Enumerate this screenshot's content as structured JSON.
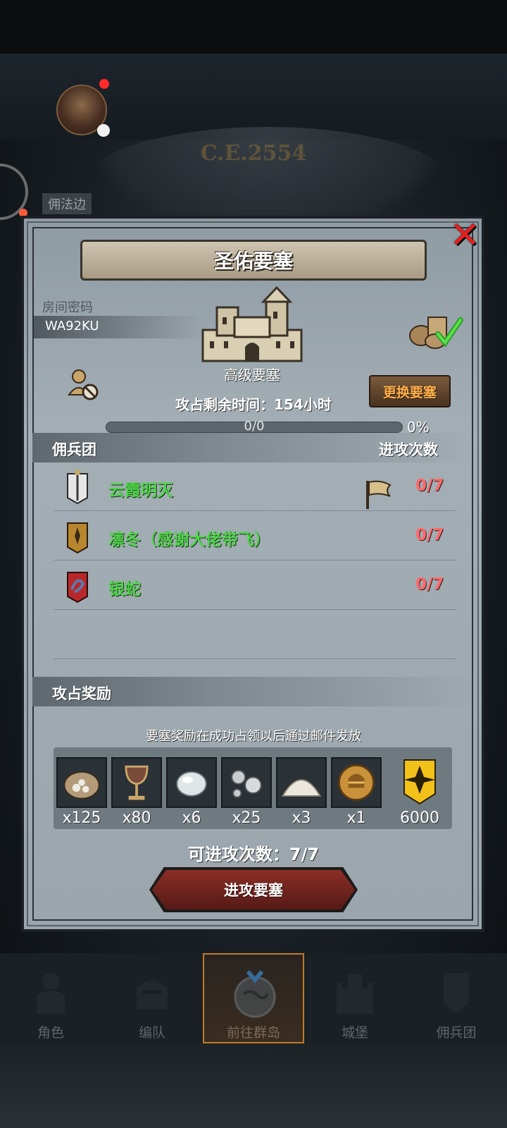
{
  "background": {
    "year_text": "C.E.2554",
    "left_label": "佣法边"
  },
  "fortress": {
    "title": "圣佑要塞",
    "room_password_label": "房间密码",
    "room_password": "WA92KU",
    "level": "高级要塞",
    "change_button": "更换要塞",
    "remaining_time": "攻占剩余时间：154小时",
    "progress_text": "0/0",
    "progress_value": 0,
    "progress_percent": "0%"
  },
  "mercenary_section": {
    "title": "佣兵团",
    "count_header": "进攻次数",
    "rows": [
      {
        "name": "云霞明灭",
        "count": "0/7",
        "emblem_color": "#e8e8e8",
        "flag": true
      },
      {
        "name": "凛冬（感谢大佬带飞）",
        "count": "0/7",
        "emblem_color": "#b8862e",
        "flag": false
      },
      {
        "name": "银蛇",
        "count": "0/7",
        "emblem_color": "#b8282a",
        "flag": false
      }
    ]
  },
  "reward_section": {
    "title": "攻占奖励",
    "note": "要塞奖励在成功占领以后通过邮件发放",
    "items": [
      {
        "icon": "salt-bag-icon",
        "qty": "x125"
      },
      {
        "icon": "goblet-icon",
        "qty": "x80"
      },
      {
        "icon": "moonstone-icon",
        "qty": "x6"
      },
      {
        "icon": "silver-beads-icon",
        "qty": "x25"
      },
      {
        "icon": "powder-pile-icon",
        "qty": "x3"
      },
      {
        "icon": "knight-helmet-coin-icon",
        "qty": "x1"
      },
      {
        "icon": "gold-banner-icon",
        "qty": "6000"
      }
    ]
  },
  "attacks_available": "可进攻次数：7/7",
  "attack_button": "进攻要塞",
  "bottom_nav": [
    {
      "label": "角色",
      "active": false
    },
    {
      "label": "编队",
      "active": false
    },
    {
      "label": "前往群岛",
      "active": true
    },
    {
      "label": "城堡",
      "active": false
    },
    {
      "label": "佣兵团",
      "active": false
    }
  ]
}
